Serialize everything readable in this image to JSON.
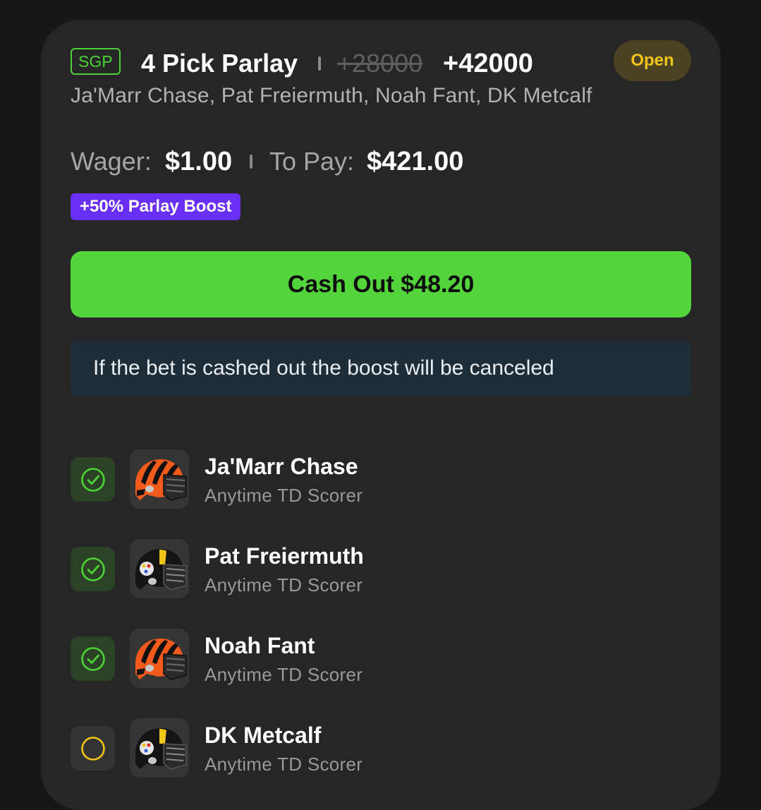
{
  "bet": {
    "type_badge": "SGP",
    "title": "4 Pick Parlay",
    "original_odds": "+28000",
    "boosted_odds": "+42000",
    "status": "Open",
    "players_summary": "Ja'Marr Chase, Pat Freiermuth, Noah Fant, DK Metcalf"
  },
  "wager": {
    "wager_label": "Wager:",
    "wager_value": "$1.00",
    "pay_label": "To Pay:",
    "pay_value": "$421.00"
  },
  "boost_badge": "+50% Parlay Boost",
  "cashout_label": "Cash Out $48.20",
  "notice": "If the bet is cashed out the boost will be canceled",
  "legs": [
    {
      "player": "Ja'Marr Chase",
      "market": "Anytime TD Scorer",
      "result": "won",
      "team_icon": "bengals-helmet-icon"
    },
    {
      "player": "Pat Freiermuth",
      "market": "Anytime TD Scorer",
      "result": "won",
      "team_icon": "steelers-helmet-icon"
    },
    {
      "player": "Noah Fant",
      "market": "Anytime TD Scorer",
      "result": "won",
      "team_icon": "bengals-helmet-icon"
    },
    {
      "player": "DK Metcalf",
      "market": "Anytime TD Scorer",
      "result": "open",
      "team_icon": "steelers-helmet-icon"
    }
  ],
  "colors": {
    "accent_green": "#52d43a",
    "status_yellow": "#f0c419",
    "boost_purple": "#6a2ff5",
    "notice_bg": "#1f2d38"
  }
}
